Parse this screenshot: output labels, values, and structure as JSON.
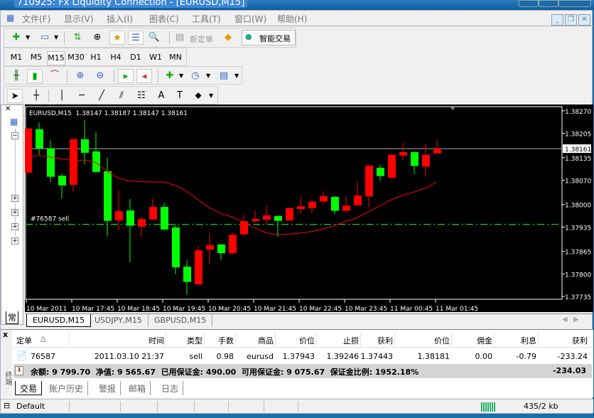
{
  "window": {
    "title": "710925: Fx Liquidity Connection - [EURUSD,M15]"
  },
  "menu": [
    "文件(F)",
    "显示(V)",
    "插入(I)",
    "图表(C)",
    "工具(T)",
    "窗口(W)",
    "帮助(H)"
  ],
  "toolbar": {
    "new_order": "新定单",
    "expert": "智能交易"
  },
  "timeframes": [
    "M1",
    "M5",
    "M15",
    "M30",
    "H1",
    "H4",
    "D1",
    "W1",
    "MN"
  ],
  "active_timeframe": "M15",
  "navigator": {
    "tab": "常"
  },
  "chart_tabs": [
    "EURUSD,M15",
    "USDJPY,M15",
    "GBPUSD,M15"
  ],
  "chart_data": {
    "type": "candlestick",
    "title": "EURUSD,M15  1.38147 1.38187 1.38147 1.38161",
    "ylim": [
      1.37727,
      1.38282
    ],
    "y_ticks": [
      "1.38270",
      "1.38205",
      "1.38135",
      "1.38070",
      "1.38000",
      "1.37935",
      "1.37865",
      "1.37800",
      "1.37735"
    ],
    "x_labels": [
      "10 Mar 2011",
      "10 Mar 17:45",
      "10 Mar 18:45",
      "10 Mar 19:45",
      "10 Mar 20:45",
      "10 Mar 21:45",
      "10 Mar 22:45",
      "10 Mar 23:45",
      "11 Mar 00:45",
      "11 Mar 01:45"
    ],
    "x_label_every": 4,
    "bid": "1.38161",
    "order_line": {
      "label": "#76587 sell",
      "price": 1.37943
    },
    "up_color": "#ff0000",
    "down_color": "#00ff00",
    "ma_color": "#ff0000",
    "ohlc": [
      [
        1.38092,
        1.38219,
        1.38092,
        1.38219
      ],
      [
        1.38217,
        1.38236,
        1.38144,
        1.38162
      ],
      [
        1.38162,
        1.38185,
        1.38065,
        1.3808
      ],
      [
        1.38083,
        1.38088,
        1.38018,
        1.38055
      ],
      [
        1.38057,
        1.38189,
        1.38036,
        1.38188
      ],
      [
        1.38188,
        1.38243,
        1.38116,
        1.38149
      ],
      [
        1.38153,
        1.38209,
        1.3809,
        1.38094
      ],
      [
        1.38096,
        1.38135,
        1.3791,
        1.37953
      ],
      [
        1.37954,
        1.38041,
        1.37928,
        1.37981
      ],
      [
        1.37983,
        1.38016,
        1.37834,
        1.37939
      ],
      [
        1.37936,
        1.37964,
        1.37908,
        1.37958
      ],
      [
        1.37957,
        1.38017,
        1.37957,
        1.37993
      ],
      [
        1.37993,
        1.38005,
        1.37925,
        1.37928
      ],
      [
        1.37934,
        1.37943,
        1.378,
        1.37819
      ],
      [
        1.37821,
        1.37838,
        1.3774,
        1.37777
      ],
      [
        1.3777,
        1.37881,
        1.37766,
        1.37868
      ],
      [
        1.3787,
        1.37918,
        1.37826,
        1.37883
      ],
      [
        1.37885,
        1.37885,
        1.3784,
        1.3786
      ],
      [
        1.3786,
        1.37918,
        1.37856,
        1.37913
      ],
      [
        1.37914,
        1.37971,
        1.37908,
        1.37952
      ],
      [
        1.37952,
        1.37983,
        1.37948,
        1.37958
      ],
      [
        1.37956,
        1.37997,
        1.37943,
        1.37969
      ],
      [
        1.37967,
        1.37967,
        1.37907,
        1.37953
      ],
      [
        1.37954,
        1.3799,
        1.37954,
        1.3799
      ],
      [
        1.37987,
        1.38022,
        1.37973,
        1.37995
      ],
      [
        1.3799,
        1.38016,
        1.37976,
        1.38008
      ],
      [
        1.38009,
        1.38039,
        1.38002,
        1.38024
      ],
      [
        1.38022,
        1.38024,
        1.37973,
        1.37982
      ],
      [
        1.37982,
        1.38024,
        1.37977,
        1.37997
      ],
      [
        1.37998,
        1.38063,
        1.37997,
        1.38026
      ],
      [
        1.38023,
        1.38116,
        1.37992,
        1.38112
      ],
      [
        1.38106,
        1.38114,
        1.38068,
        1.38082
      ],
      [
        1.38077,
        1.38145,
        1.38072,
        1.38143
      ],
      [
        1.38141,
        1.38178,
        1.38127,
        1.38151
      ],
      [
        1.38151,
        1.38153,
        1.38088,
        1.38111
      ],
      [
        1.38109,
        1.38176,
        1.3808,
        1.38143
      ],
      [
        1.38147,
        1.38187,
        1.38147,
        1.38161
      ]
    ],
    "ma": [
      1.38137,
      1.38141,
      1.38137,
      1.38131,
      1.38127,
      1.38128,
      1.38121,
      1.38096,
      1.38075,
      1.38068,
      1.38066,
      1.38065,
      1.38065,
      1.38055,
      1.38038,
      1.38014,
      1.3799,
      1.37974,
      1.37964,
      1.37949,
      1.37932,
      1.37918,
      1.37913,
      1.37915,
      1.37918,
      1.37922,
      1.3793,
      1.37939,
      1.37952,
      1.37962,
      1.3798,
      1.37997,
      1.38014,
      1.38027,
      1.38036,
      1.38048,
      1.38065
    ]
  },
  "terminal": {
    "side_label": "终端",
    "headers": [
      "定单",
      "时间",
      "类型",
      "手数",
      "商品",
      "价位",
      "止损",
      "获利",
      "价位",
      "佣金",
      "利息",
      "获利"
    ],
    "rows": [
      [
        "76587",
        "2011.03.10 21:37",
        "sell",
        "0.98",
        "eurusd",
        "1.37943",
        "1.39246",
        "1.37443",
        "1.38181",
        "0.00",
        "-0.79",
        "-233.24"
      ]
    ],
    "summary": "余额: 9 799.70  净值: 9 565.67  已用保证金: 490.00  可用保证金: 9 075.67  保证金比例: 1952.18%",
    "summary_total": "-234.03",
    "tabs": [
      "交易",
      "账户历史",
      "警报",
      "邮箱",
      "日志"
    ]
  },
  "status": {
    "profile": "Default",
    "traffic": "435/2 kb"
  }
}
